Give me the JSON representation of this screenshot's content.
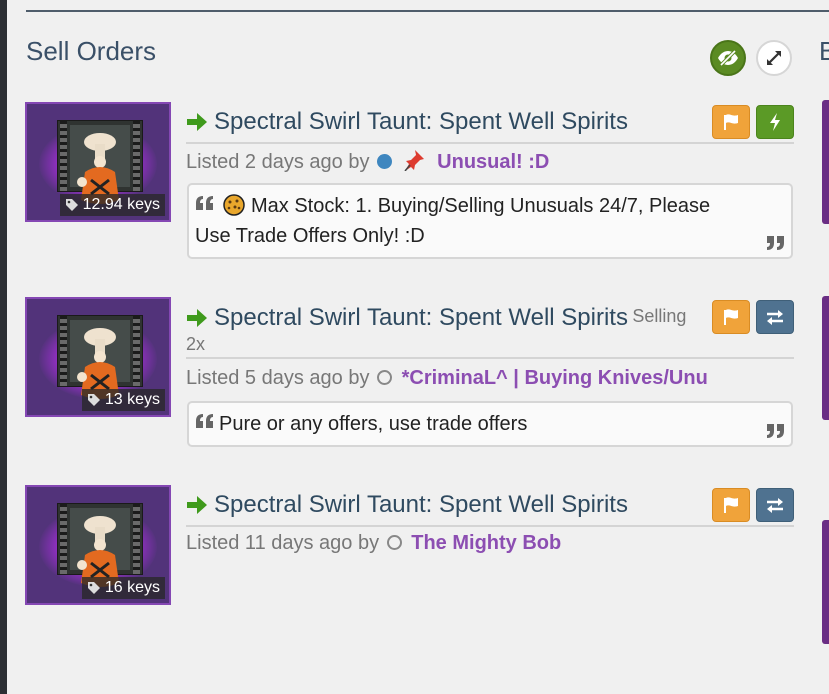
{
  "page": {
    "section_title": "Sell Orders",
    "next_section_initial": "B"
  },
  "orders": [
    {
      "title": "Spectral Swirl Taunt: Spent Well Spirits",
      "quantity": "",
      "price": "12.94 keys",
      "listed_prefix": "Listed 2 days ago by",
      "user_status": "online",
      "user": "Unusual! :D",
      "user_badge": "pushpin-icon",
      "buttons": [
        "report",
        "instant-buy"
      ],
      "comment": "Max Stock: 1. Buying/Selling Unusuals 24/7, Please Use Trade Offers Only! :D",
      "comment_icon": "cookie-icon"
    },
    {
      "title": "Spectral Swirl Taunt: Spent Well Spirits",
      "quantity_label": "Selling",
      "quantity": "2x",
      "price": "13 keys",
      "listed_prefix": "Listed 5 days ago by",
      "user_status": "offline",
      "user": "*CriminaL^ | Buying Knives/Unu",
      "buttons": [
        "report",
        "trade-offer"
      ],
      "comment": "Pure or any offers, use trade offers"
    },
    {
      "title": "Spectral Swirl Taunt: Spent Well Spirits",
      "quantity": "",
      "price": "16 keys",
      "listed_prefix": "Listed 11 days ago by",
      "user_status": "offline",
      "user": "The Mighty Bob",
      "buttons": [
        "report",
        "trade-offer"
      ]
    }
  ],
  "colors": {
    "title": "#2f4a60",
    "username": "#8c4eb2",
    "arrow": "#3f9a1c",
    "orange_button": "#f0a33a",
    "green_button": "#5b9a26",
    "blue_button": "#4f7290",
    "item_frame": "#8447b3"
  }
}
